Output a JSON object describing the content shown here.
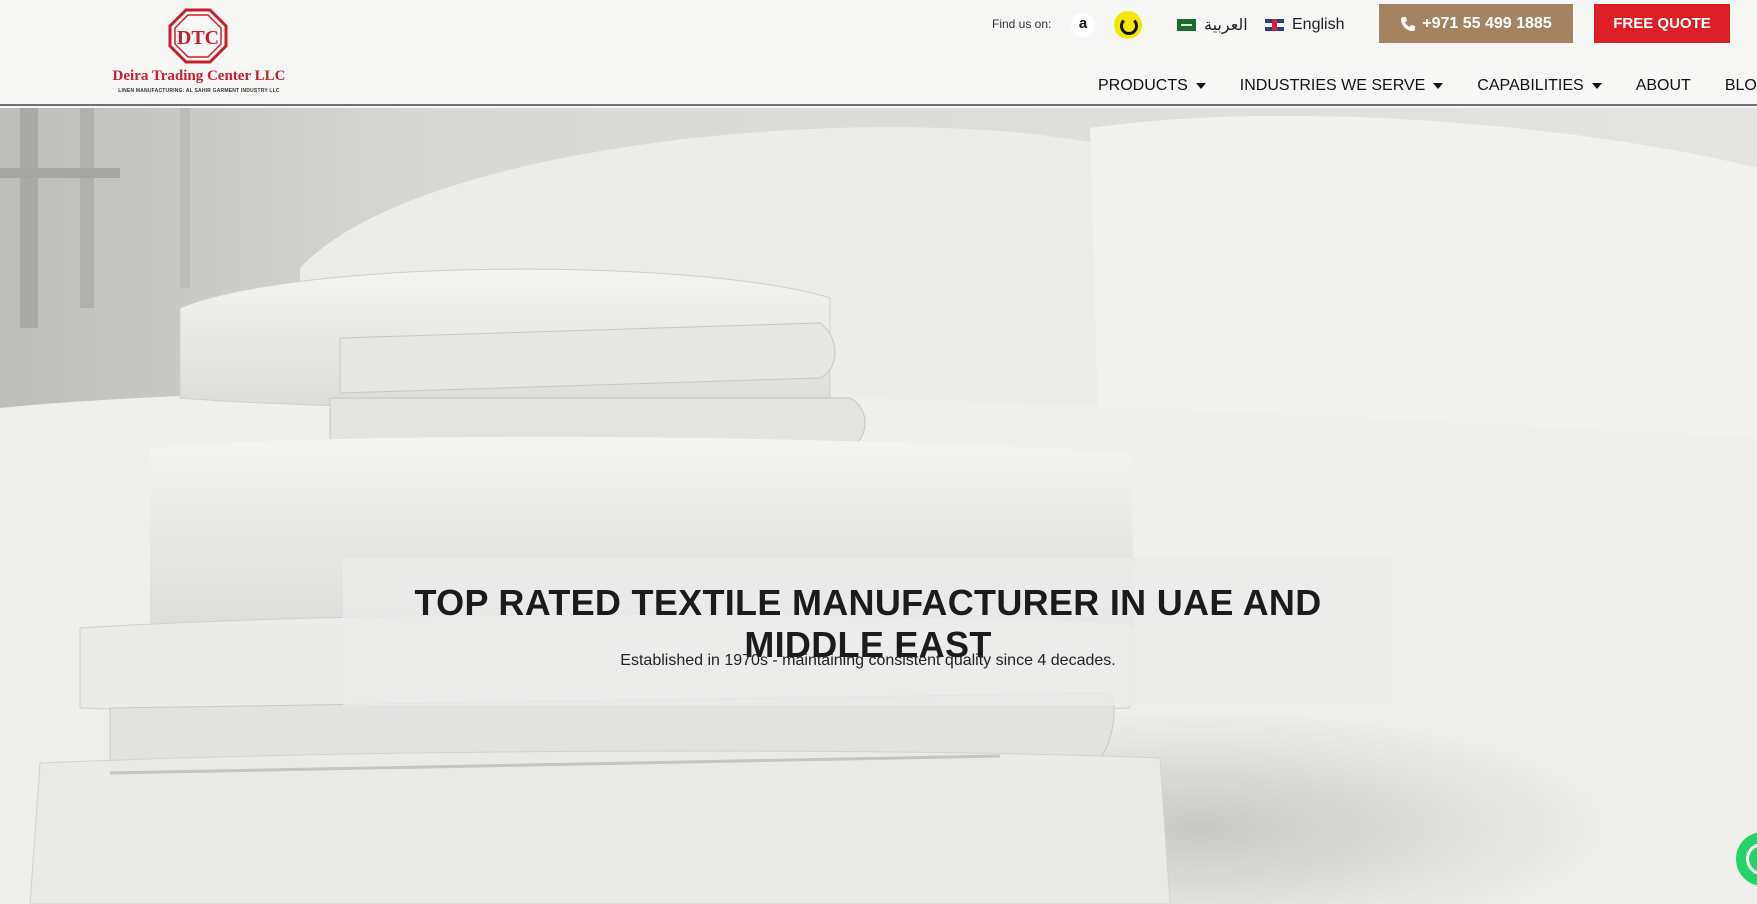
{
  "header": {
    "logo": {
      "initials": "DTC",
      "name": "Deira Trading Center LLC",
      "tagline": "LINEN MANUFACTURING: AL SAHIR GARMENT INDUSTRY LLC",
      "brand_color": "#c8202a"
    },
    "find_us_label": "Find us on:",
    "marketplaces": [
      {
        "name": "amazon-icon",
        "glyph": "a"
      },
      {
        "name": "noon-icon",
        "glyph": ""
      }
    ],
    "languages": [
      {
        "label": "العربية",
        "flag": "saudi-flag-icon"
      },
      {
        "label": "English",
        "flag": "uk-flag-icon"
      }
    ],
    "phone_button": {
      "label": "+971 55 499 1885",
      "color": "#a48363"
    },
    "quote_button": {
      "label": "FREE QUOTE",
      "color": "#dc1f26"
    },
    "nav": [
      {
        "label": "PRODUCTS",
        "dropdown": true
      },
      {
        "label": "INDUSTRIES WE SERVE",
        "dropdown": true
      },
      {
        "label": "CAPABILITIES",
        "dropdown": true
      },
      {
        "label": "ABOUT",
        "dropdown": false
      },
      {
        "label": "BLOG",
        "dropdown": false
      }
    ]
  },
  "hero": {
    "title": "TOP RATED TEXTILE MANUFACTURER IN UAE AND MIDDLE EAST",
    "subtitle": "Established in 1970s - maintaining consistent quality since 4 decades.",
    "image": "stack-of-white-towels-on-bed"
  },
  "floating": {
    "whatsapp_icon": "whatsapp-icon",
    "color": "#25d366"
  }
}
